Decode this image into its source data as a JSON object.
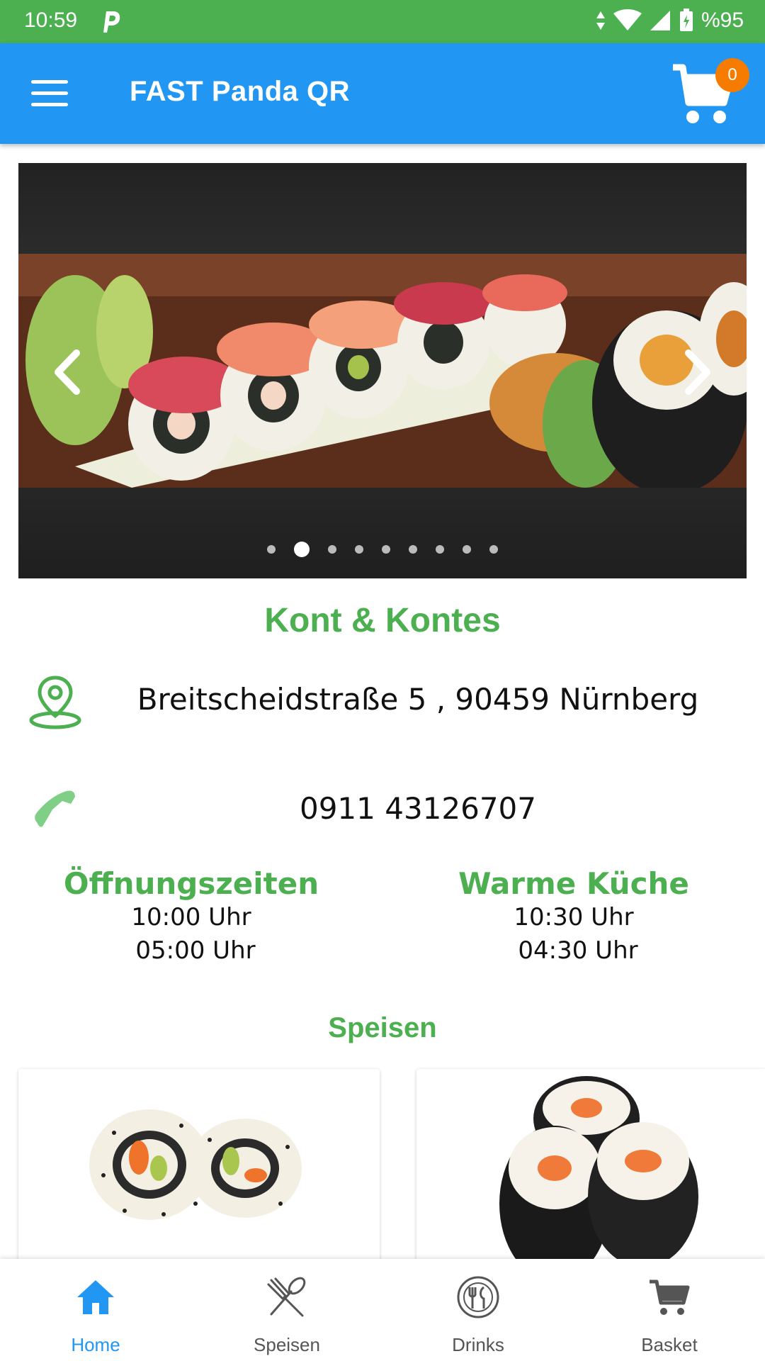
{
  "status_bar": {
    "time": "10:59",
    "battery": "%95"
  },
  "app_bar": {
    "title": "FAST Panda QR",
    "cart_count": "0"
  },
  "carousel": {
    "slide_count": 9,
    "active_index": 1
  },
  "restaurant": {
    "name": "Kont & Kontes",
    "address": "Breitscheidstraße 5 , 90459 Nürnberg",
    "phone": "0911 43126707"
  },
  "hours": [
    {
      "title": "Öffnungszeiten",
      "open": "10:00 Uhr",
      "close": "05:00 Uhr"
    },
    {
      "title": "Warme Küche",
      "open": "10:30 Uhr",
      "close": "04:30 Uhr"
    }
  ],
  "section": {
    "title": "Speisen"
  },
  "colors": {
    "primary": "#2196F3",
    "accent": "#4CAF50",
    "badge": "#F57C00"
  },
  "bottom_nav": [
    {
      "label": "Home",
      "icon": "home-icon",
      "active": true
    },
    {
      "label": "Speisen",
      "icon": "fork-spoon-icon",
      "active": false
    },
    {
      "label": "Drinks",
      "icon": "plate-cutlery-icon",
      "active": false
    },
    {
      "label": "Basket",
      "icon": "cart-icon",
      "active": false
    }
  ]
}
